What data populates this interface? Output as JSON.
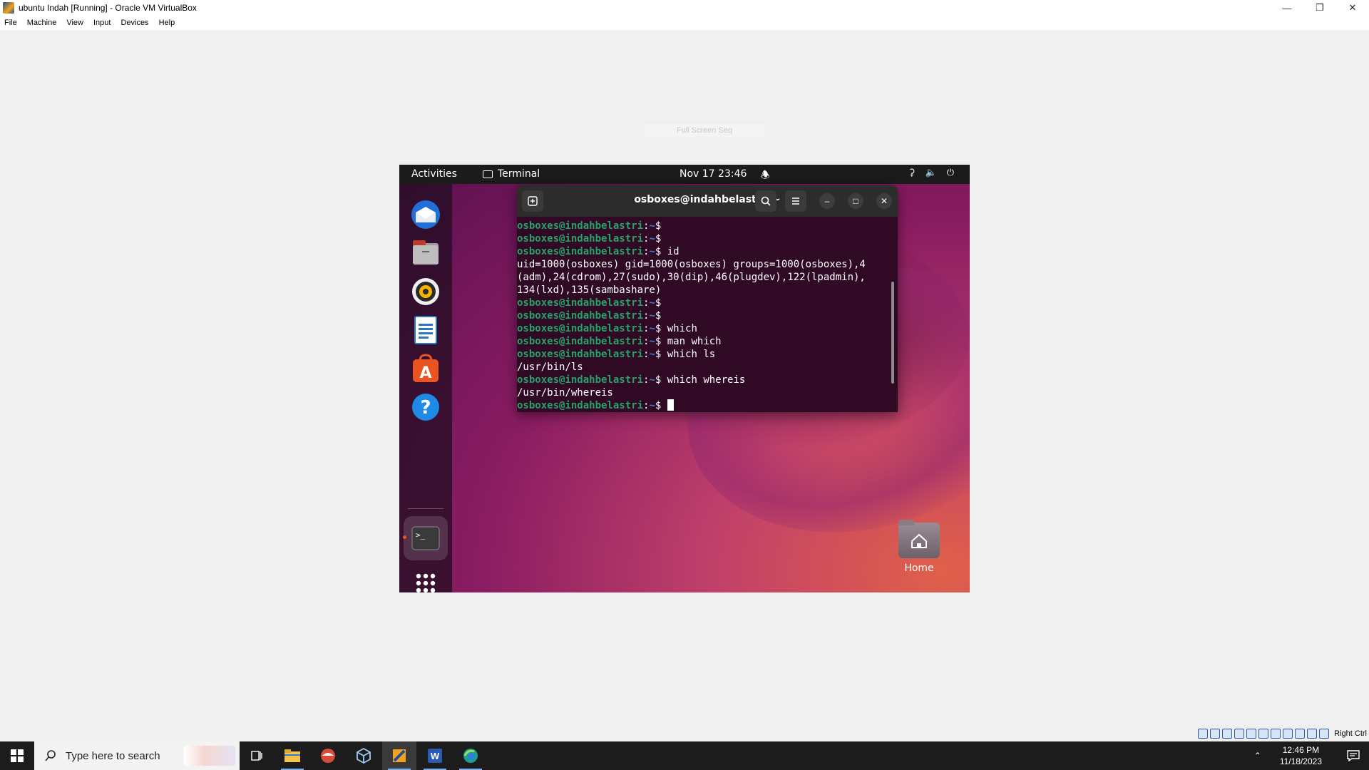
{
  "window": {
    "title": "ubuntu Indah [Running] - Oracle VM VirtualBox",
    "controls": [
      "minimize",
      "restore",
      "close"
    ]
  },
  "menubar": [
    "File",
    "Machine",
    "View",
    "Input",
    "Devices",
    "Help"
  ],
  "hint_box": "Full Screen Seq",
  "ubuntu": {
    "topbar": {
      "activities": "Activities",
      "app": "Terminal",
      "clock": "Nov 17  23:46"
    },
    "dock": [
      {
        "name": "thunderbird-icon"
      },
      {
        "name": "files-icon"
      },
      {
        "name": "rhythmbox-icon"
      },
      {
        "name": "libreoffice-writer-icon"
      },
      {
        "name": "app-center-icon"
      },
      {
        "name": "help-icon"
      },
      {
        "name": "terminal-icon"
      },
      {
        "name": "show-apps-icon"
      }
    ],
    "terminal": {
      "title": "osboxes@indahbelastri: ~",
      "prompt_user": "osboxes@indahbelastri",
      "prompt_path": "~",
      "lines": [
        {
          "type": "prompt",
          "cmd": ""
        },
        {
          "type": "prompt",
          "cmd": ""
        },
        {
          "type": "prompt",
          "cmd": "id"
        },
        {
          "type": "output",
          "text": "uid=1000(osboxes) gid=1000(osboxes) groups=1000(osboxes),4"
        },
        {
          "type": "output",
          "text": "(adm),24(cdrom),27(sudo),30(dip),46(plugdev),122(lpadmin),"
        },
        {
          "type": "output",
          "text": "134(lxd),135(sambashare)"
        },
        {
          "type": "prompt",
          "cmd": ""
        },
        {
          "type": "prompt",
          "cmd": ""
        },
        {
          "type": "prompt",
          "cmd": "which"
        },
        {
          "type": "prompt",
          "cmd": "man which"
        },
        {
          "type": "prompt",
          "cmd": "which ls"
        },
        {
          "type": "output",
          "text": "/usr/bin/ls"
        },
        {
          "type": "prompt",
          "cmd": "which whereis"
        },
        {
          "type": "output",
          "text": "/usr/bin/whereis"
        },
        {
          "type": "prompt",
          "cmd": "",
          "cursor": true
        }
      ]
    },
    "desktop": {
      "home_label": "Home"
    }
  },
  "vm_status": {
    "host_key": "Right Ctrl"
  },
  "taskbar": {
    "search_placeholder": "Type here to search",
    "time": "12:46 PM",
    "date": "11/18/2023"
  }
}
